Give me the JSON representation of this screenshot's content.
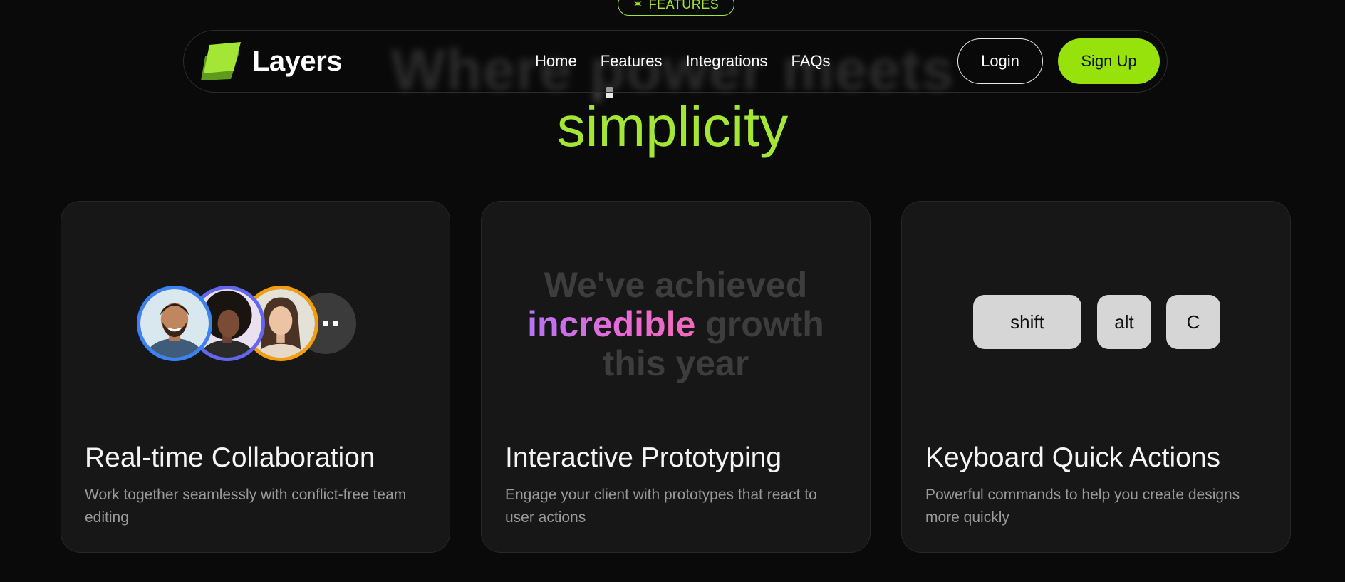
{
  "eyebrow": {
    "icon": "sparkle-icon",
    "label": "FEATURES"
  },
  "headline": {
    "line1": "Where power meets",
    "accent": "simplicity"
  },
  "nav": {
    "brand": "Layers",
    "links": [
      "Home",
      "Features",
      "Integrations",
      "FAQs"
    ],
    "login": "Login",
    "signup": "Sign Up"
  },
  "colors": {
    "accent": "#97e20a",
    "background": "#0a0a0a",
    "card": "#171717"
  },
  "cards": [
    {
      "title": "Real-time Collaboration",
      "description": "Work together seamlessly with conflict-free team editing",
      "avatar_ring_colors": [
        "#3b82f6",
        "#6366f1",
        "#f59e0b"
      ]
    },
    {
      "title": "Interactive Prototyping",
      "description": "Engage your client with prototypes that react to user actions",
      "text_before": "We've achieved",
      "highlight": "incredible",
      "text_after": "growth",
      "line3": "this year"
    },
    {
      "title": "Keyboard Quick Actions",
      "description": "Powerful commands to help you create designs more quickly",
      "keys": [
        "shift",
        "alt",
        "C"
      ]
    }
  ]
}
